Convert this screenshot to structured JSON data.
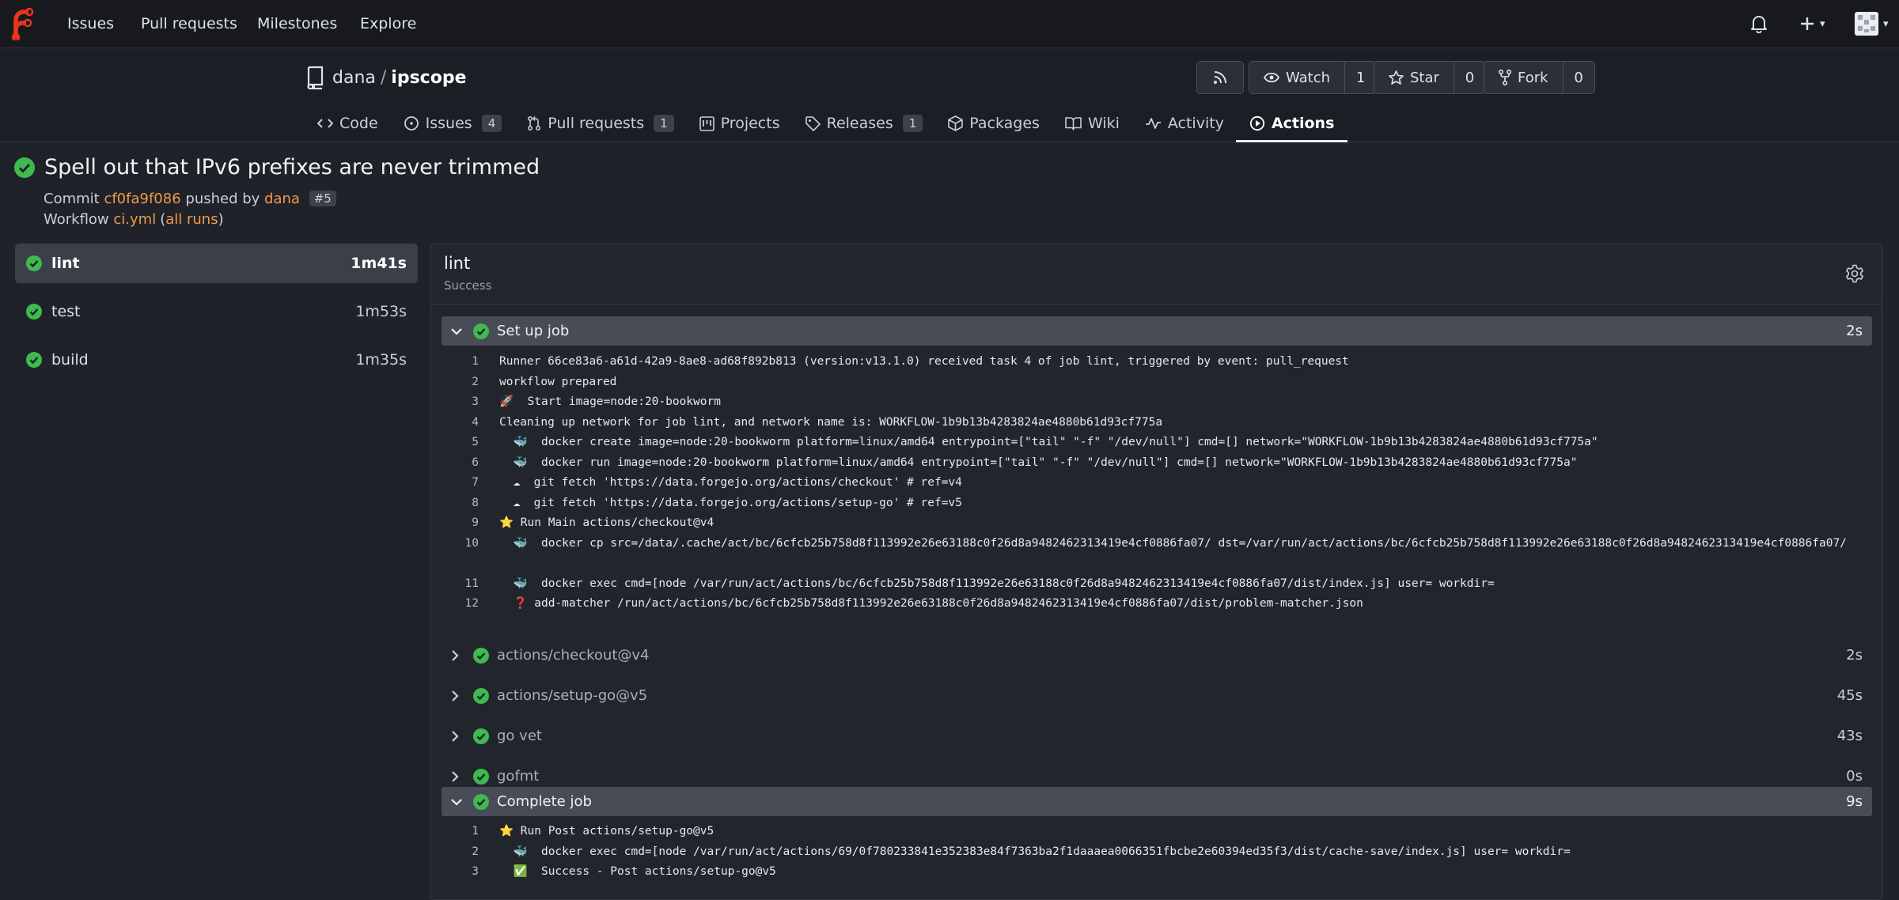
{
  "topnav": {
    "links": [
      "Issues",
      "Pull requests",
      "Milestones",
      "Explore"
    ],
    "icons": [
      "bell-icon",
      "plus-icon",
      "avatar"
    ],
    "plus_caret": "▾",
    "avatar_caret": "▾"
  },
  "repo": {
    "owner": "dana",
    "separator": "/",
    "name": "ipscope",
    "rss_icon": "rss-icon",
    "watch": {
      "label": "Watch",
      "count": "1"
    },
    "star": {
      "label": "Star",
      "count": "0"
    },
    "fork": {
      "label": "Fork",
      "count": "0"
    },
    "tabs": [
      {
        "label": "Code",
        "icon": "code-icon",
        "badge": ""
      },
      {
        "label": "Issues",
        "icon": "issue-icon",
        "badge": "4"
      },
      {
        "label": "Pull requests",
        "icon": "pull-request-icon",
        "badge": "1"
      },
      {
        "label": "Projects",
        "icon": "project-icon",
        "badge": ""
      },
      {
        "label": "Releases",
        "icon": "tag-icon",
        "badge": "1"
      },
      {
        "label": "Packages",
        "icon": "package-icon",
        "badge": ""
      },
      {
        "label": "Wiki",
        "icon": "book-icon",
        "badge": ""
      },
      {
        "label": "Activity",
        "icon": "pulse-icon",
        "badge": ""
      },
      {
        "label": "Actions",
        "icon": "play-icon",
        "badge": "",
        "active": true
      }
    ]
  },
  "run": {
    "title": "Spell out that IPv6 prefixes are never trimmed",
    "commit_prefix": "Commit",
    "commit_sha": "cf0fa9f086",
    "pushed_by": "pushed by",
    "author": "dana",
    "pr_ref": "#5",
    "workflow_prefix": "Workflow",
    "workflow_file": "ci.yml",
    "open_paren": "(",
    "all_runs": "all runs",
    "close_paren": ")"
  },
  "jobs": [
    {
      "name": "lint",
      "duration": "1m41s",
      "status": "success",
      "active": true
    },
    {
      "name": "test",
      "duration": "1m53s",
      "status": "success"
    },
    {
      "name": "build",
      "duration": "1m35s",
      "status": "success"
    }
  ],
  "job_detail": {
    "title": "lint",
    "status_text": "Success",
    "steps": [
      {
        "name": "Set up job",
        "duration": "2s",
        "expanded": true
      },
      {
        "name": "actions/checkout@v4",
        "duration": "2s"
      },
      {
        "name": "actions/setup-go@v5",
        "duration": "45s"
      },
      {
        "name": "go vet",
        "duration": "43s"
      },
      {
        "name": "gofmt",
        "duration": "0s"
      },
      {
        "name": "Complete job",
        "duration": "9s",
        "expanded": true
      }
    ],
    "setup_log": [
      {
        "n": "1",
        "text": "Runner 66ce83a6-a61d-42a9-8ae8-ad68f892b813 (version:v13.1.0) received task 4 of job lint, triggered by event: pull_request"
      },
      {
        "n": "2",
        "text": "workflow prepared"
      },
      {
        "n": "3",
        "text": "🚀  Start image=node:20-bookworm"
      },
      {
        "n": "4",
        "text": "Cleaning up network for job lint, and network name is: WORKFLOW-1b9b13b4283824ae4880b61d93cf775a"
      },
      {
        "n": "5",
        "text": "  🐳  docker create image=node:20-bookworm platform=linux/amd64 entrypoint=[\"tail\" \"-f\" \"/dev/null\"] cmd=[] network=\"WORKFLOW-1b9b13b4283824ae4880b61d93cf775a\""
      },
      {
        "n": "6",
        "text": "  🐳  docker run image=node:20-bookworm platform=linux/amd64 entrypoint=[\"tail\" \"-f\" \"/dev/null\"] cmd=[] network=\"WORKFLOW-1b9b13b4283824ae4880b61d93cf775a\""
      },
      {
        "n": "7",
        "text": "  ☁  git fetch 'https://data.forgejo.org/actions/checkout' # ref=v4"
      },
      {
        "n": "8",
        "text": "  ☁  git fetch 'https://data.forgejo.org/actions/setup-go' # ref=v5"
      },
      {
        "n": "9",
        "text": "⭐ Run Main actions/checkout@v4"
      },
      {
        "n": "10",
        "text": "  🐳  docker cp src=/data/.cache/act/bc/6cfcb25b758d8f113992e26e63188c0f26d8a9482462313419e4cf0886fa07/ dst=/var/run/act/actions/bc/6cfcb25b758d8f113992e26e63188c0f26d8a9482462313419e4cf0886fa07/",
        "wrap": true
      },
      {
        "n": "11",
        "text": "  🐳  docker exec cmd=[node /var/run/act/actions/bc/6cfcb25b758d8f113992e26e63188c0f26d8a9482462313419e4cf0886fa07/dist/index.js] user= workdir="
      },
      {
        "n": "12",
        "text": "  ❓ add-matcher /run/act/actions/bc/6cfcb25b758d8f113992e26e63188c0f26d8a9482462313419e4cf0886fa07/dist/problem-matcher.json"
      }
    ],
    "complete_log": [
      {
        "n": "1",
        "text": "⭐ Run Post actions/setup-go@v5"
      },
      {
        "n": "2",
        "text": "  🐳  docker exec cmd=[node /var/run/act/actions/69/0f780233841e352383e84f7363ba2f1daaaea0066351fbcbe2e60394ed35f3/dist/cache-save/index.js] user= workdir="
      },
      {
        "n": "3",
        "text": "  ✅  Success - Post actions/setup-go@v5"
      }
    ]
  },
  "colors": {
    "success": "#3fb950",
    "link": "#f09a4b",
    "logo": "#e8361b"
  }
}
